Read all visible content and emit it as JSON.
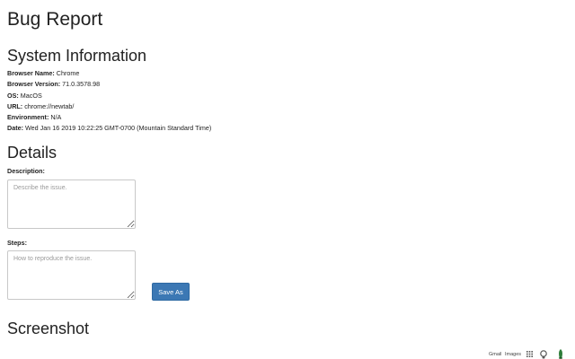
{
  "page": {
    "title": "Bug Report"
  },
  "system_info": {
    "heading": "System Information",
    "rows": [
      {
        "label": "Browser Name",
        "value": "Chrome"
      },
      {
        "label": "Browser Version",
        "value": "71.0.3578.98"
      },
      {
        "label": "OS",
        "value": "MacOS"
      },
      {
        "label": "URL",
        "value": "chrome://newtab/"
      },
      {
        "label": "Environment",
        "value": "N/A"
      },
      {
        "label": "Date",
        "value": "Wed Jan 16 2019 10:22:25 GMT-0700 (Mountain Standard Time)"
      }
    ]
  },
  "details": {
    "heading": "Details",
    "description_label": "Description:",
    "description_placeholder": "Describe the issue.",
    "steps_label": "Steps:",
    "steps_placeholder": "How to reproduce the issue.",
    "save_button_label": "Save As"
  },
  "screenshot": {
    "heading": "Screenshot"
  },
  "google_bar": {
    "gmail_label": "Gmail",
    "images_label": "Images",
    "apps_icon": "apps-grid-icon",
    "account_icon": "account-icon"
  },
  "colors": {
    "button_background": "#3c78b4",
    "text": "#222222",
    "field_border": "#c8c8c8"
  }
}
